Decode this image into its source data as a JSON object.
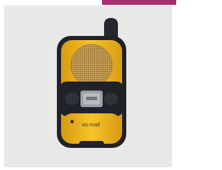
{
  "product": {
    "name": "walkie-talkie",
    "brand_label": "vo-mail",
    "colors": {
      "body": "#f2bb22",
      "trim": "#1f2228",
      "display": "#9aa0a4",
      "background": "#e8e8e6",
      "accent": "#a8306e"
    }
  }
}
